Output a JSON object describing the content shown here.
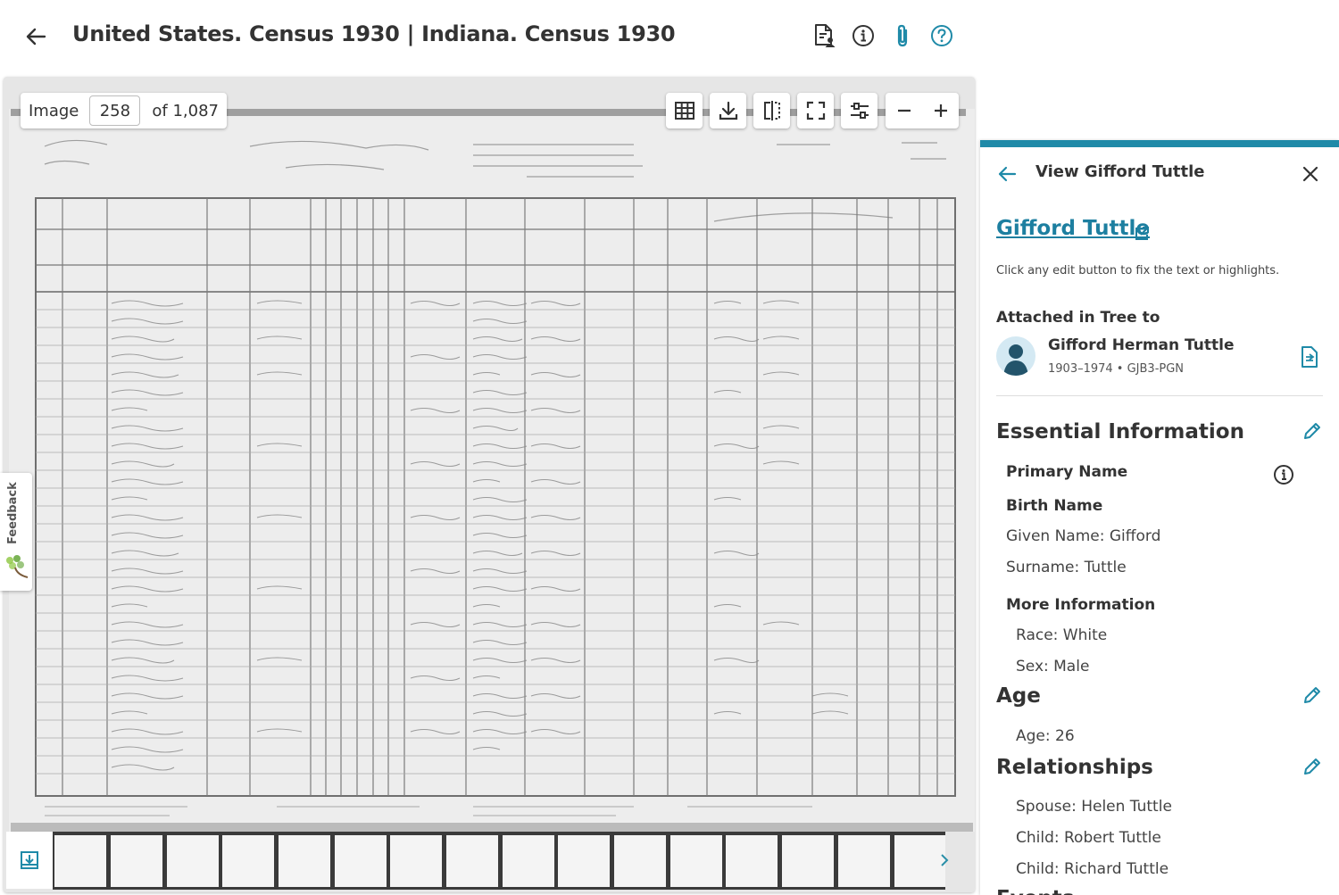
{
  "header": {
    "title": "United States. Census 1930 | Indiana. Census 1930"
  },
  "viewer": {
    "image_label": "Image",
    "page_value": "258",
    "page_total": "of 1,087",
    "feedback_label": "Feedback"
  },
  "panel": {
    "title": "View Gifford Tuttle",
    "person_name": "Gifford Tuttle",
    "hint": "Click any edit button to fix the text or highlights.",
    "attached_label": "Attached in Tree to",
    "tree_person_name": "Gifford Herman Tuttle",
    "tree_person_meta": "1903–1974 • GJB3-PGN",
    "essential_title": "Essential Information",
    "primary_name": "Primary Name",
    "birth_name": "Birth Name",
    "given_name": "Given Name: Gifford",
    "surname": "Surname: Tuttle",
    "more_info": "More Information",
    "race": "Race: White",
    "sex": "Sex: Male",
    "age_title": "Age",
    "age_value": "Age: 26",
    "relationships_title": "Relationships",
    "spouse": "Spouse: Helen Tuttle",
    "child1": "Child: Robert Tuttle",
    "child2": "Child: Richard Tuttle",
    "events_title": "Events"
  },
  "colors": {
    "accent": "#1f8aa8",
    "link": "#1d7fa0",
    "text": "#333333"
  },
  "icons": [
    "back-arrow-icon",
    "record-person-icon",
    "info-icon",
    "attachment-icon",
    "help-icon",
    "grid-icon",
    "download-icon",
    "compare-icon",
    "fullscreen-icon",
    "adjust-icon",
    "zoom-out-icon",
    "zoom-in-icon",
    "close-icon",
    "external-link-icon",
    "edit-pencil-icon"
  ]
}
